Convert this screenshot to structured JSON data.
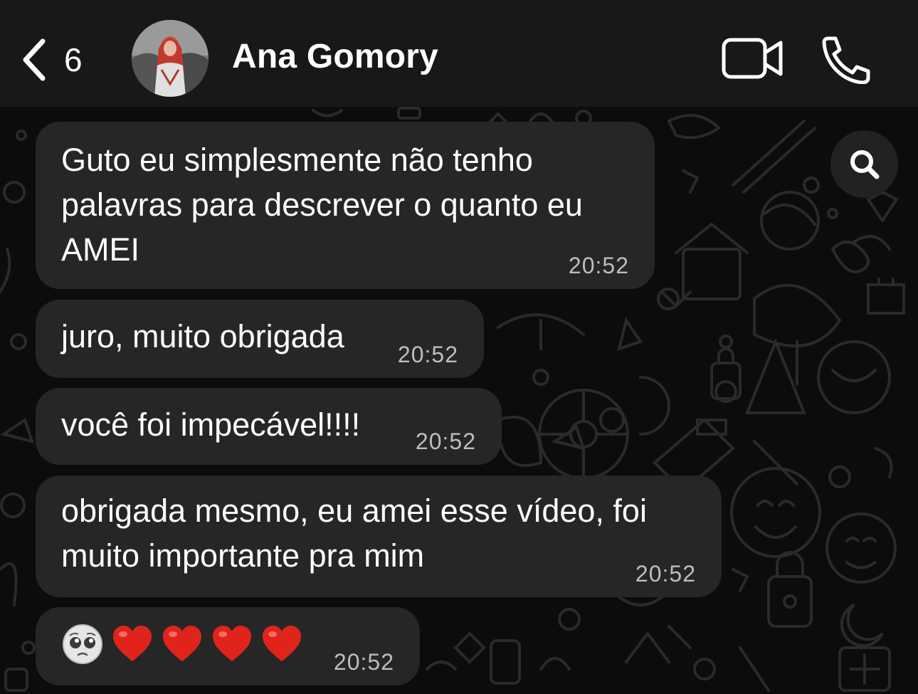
{
  "header": {
    "back_count": "6",
    "contact_name": "Ana Gomory"
  },
  "icons": {
    "back": "chevron-left-icon",
    "video": "video-camera-icon",
    "call": "phone-icon",
    "search": "search-icon"
  },
  "colors": {
    "header_bg": "#181818",
    "chat_bg": "#0c0c0c",
    "bubble_bg": "#262626",
    "timestamp": "#bdbdbd",
    "heart": "#e0241b"
  },
  "messages": [
    {
      "lines": [
        "Guto eu simplesmente não tenho",
        "palavras para descrever o quanto eu",
        "AMEI"
      ],
      "time": "20:52"
    },
    {
      "lines": [
        "juro, muito obrigada"
      ],
      "time": "20:52"
    },
    {
      "lines": [
        "você foi impecável!!!!"
      ],
      "time": "20:52"
    },
    {
      "lines": [
        "obrigada mesmo, eu amei esse vídeo, foi",
        "muito importante pra mim"
      ],
      "time": "20:52"
    },
    {
      "emojis": [
        "pleading-face",
        "red-heart",
        "red-heart",
        "red-heart",
        "red-heart"
      ],
      "time": "20:52"
    }
  ]
}
